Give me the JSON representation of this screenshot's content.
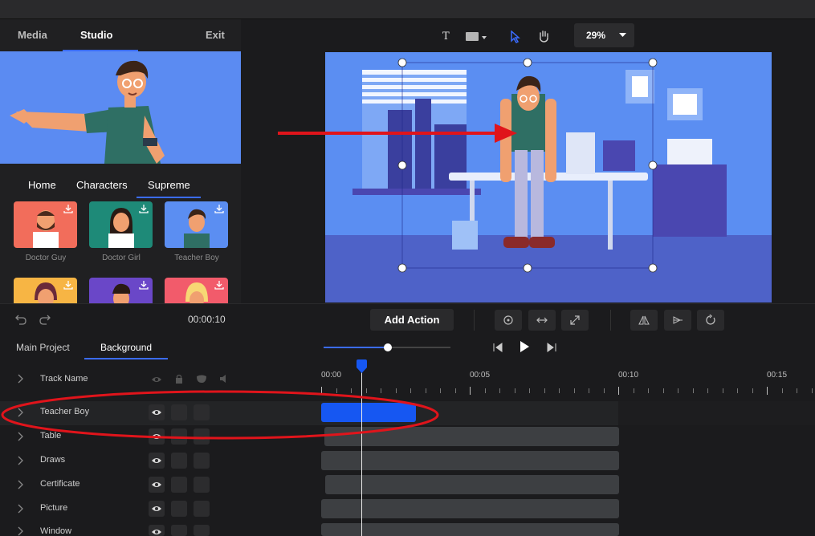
{
  "top_tabs": {
    "media": "Media",
    "studio": "Studio",
    "exit": "Exit"
  },
  "categories": [
    "Home",
    "Characters",
    "Supreme"
  ],
  "characters": [
    {
      "label": "Doctor Guy",
      "bg": "#f26d5b"
    },
    {
      "label": "Doctor Girl",
      "bg": "#1e8a78"
    },
    {
      "label": "Teacher Boy",
      "bg": "#5b8ef2"
    },
    {
      "label": "",
      "bg": "#f7b544"
    },
    {
      "label": "",
      "bg": "#6a47c8"
    },
    {
      "label": "",
      "bg": "#f25b6b"
    }
  ],
  "toolbar": {
    "text_tool": "T",
    "zoom": "29%"
  },
  "actions": {
    "time": "00:00:10",
    "add_action": "Add Action"
  },
  "project_tabs": {
    "main": "Main Project",
    "background": "Background"
  },
  "timeline": {
    "header": "Track Name",
    "time_labels": [
      "00:00",
      "00:05",
      "00:10",
      "00:15"
    ],
    "tracks": [
      "Teacher Boy",
      "Table",
      "Draws",
      "Certificate",
      "Picture",
      "Window"
    ]
  },
  "colors": {
    "accent": "#3b6cff",
    "annotation": "#e0141b"
  }
}
